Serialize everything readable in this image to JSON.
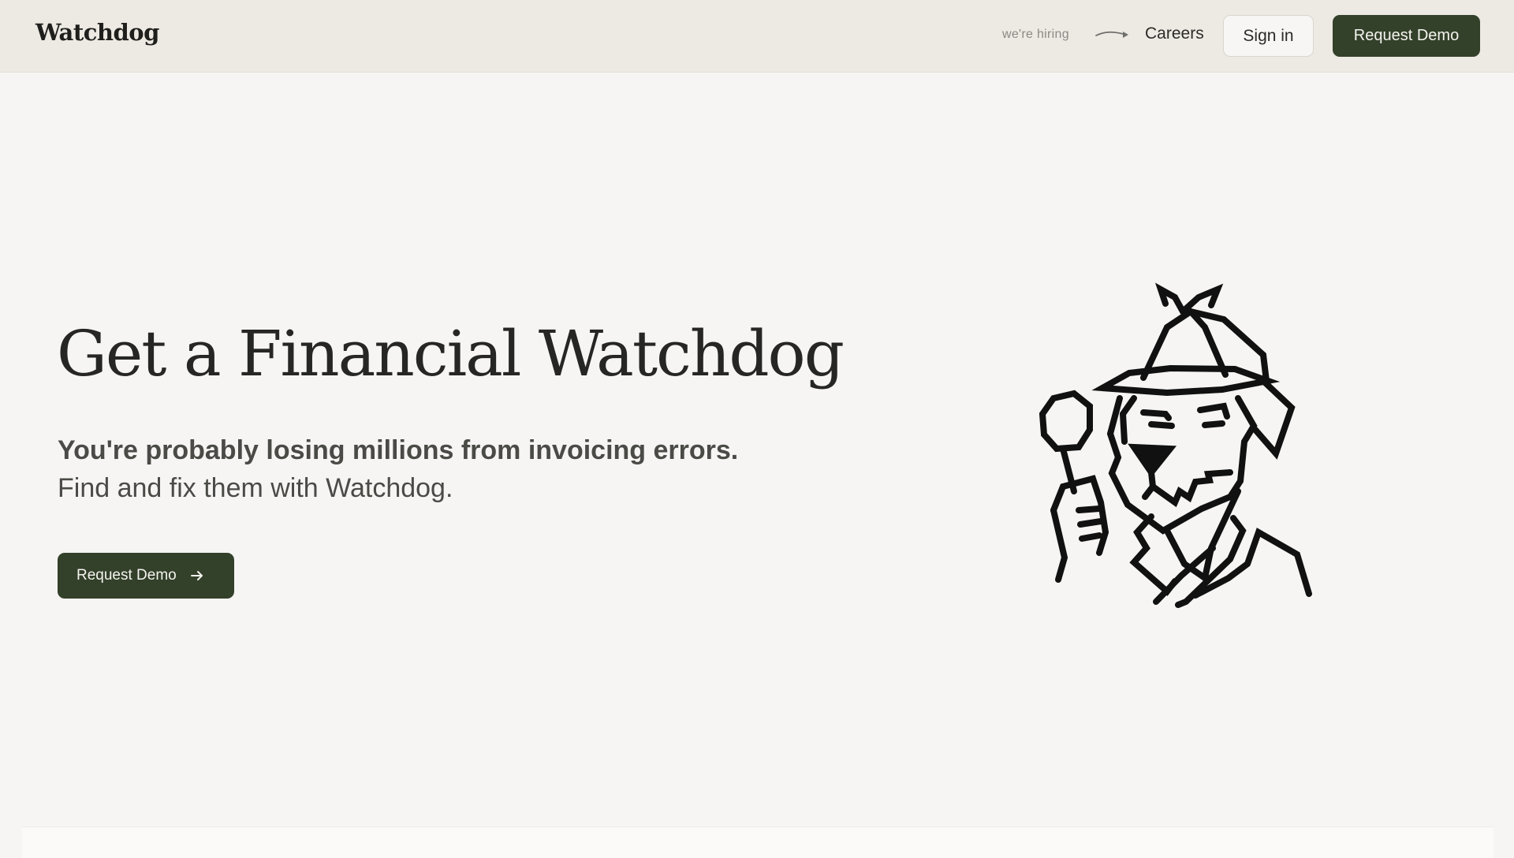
{
  "header": {
    "logo": "Watchdog",
    "hiring_note": "we're hiring",
    "careers_label": "Careers",
    "signin_label": "Sign in",
    "request_demo_label": "Request Demo"
  },
  "hero": {
    "title": "Get a Financial Watchdog",
    "lead": "You're probably losing millions from invoicing errors.",
    "sub": "Find and fix them with Watchdog.",
    "cta_label": "Request Demo",
    "cta_icon": "arrow-right-icon",
    "illustration": "detective-dog-illustration"
  },
  "colors": {
    "accent": "#33402a",
    "header_bg": "#ede9e3",
    "page_bg": "#f6f5f3"
  }
}
